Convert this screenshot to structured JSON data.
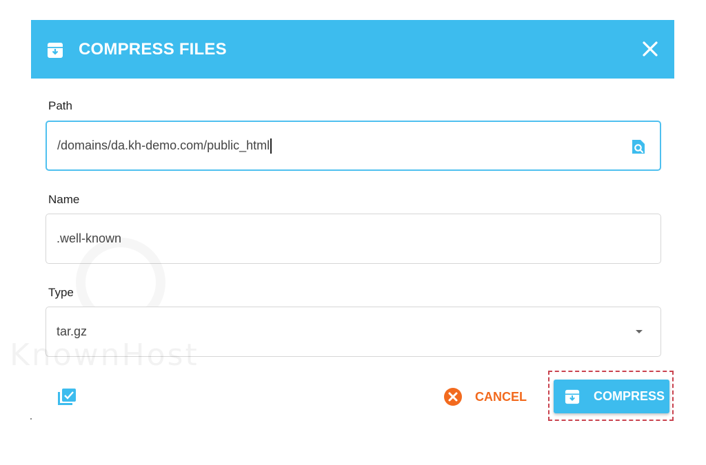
{
  "dialog": {
    "title": "COMPRESS FILES",
    "header_color": "#3dbcee"
  },
  "fields": {
    "path": {
      "label": "Path",
      "value": "/domains/da.kh-demo.com/public_html"
    },
    "name": {
      "label": "Name",
      "value": ".well-known"
    },
    "type": {
      "label": "Type",
      "value": "tar.gz"
    }
  },
  "footer": {
    "cancel_label": "CANCEL",
    "compress_label": "COMPRESS",
    "cancel_color": "#f26a1e",
    "compress_color": "#3dbcee"
  },
  "icons": {
    "header": "archive-icon",
    "close": "close-icon",
    "path_browse": "search-file-icon",
    "type_dropdown": "dropdown-arrow-icon",
    "select": "select-all-icon",
    "cancel": "cancel-icon",
    "compress": "archive-icon"
  }
}
